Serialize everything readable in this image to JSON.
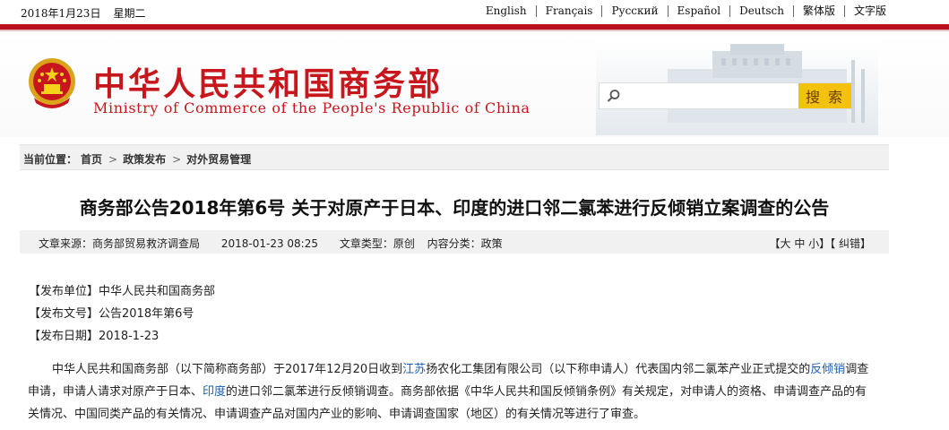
{
  "topbar": {
    "date": "2018年1月23日",
    "weekday": "星期二",
    "languages": [
      "English",
      "Français",
      "Русский",
      "Español",
      "Deutsch",
      "繁体版",
      "文字版"
    ]
  },
  "header": {
    "title_cn": "中华人民共和国商务部",
    "title_en": "Ministry of Commerce of the People's Republic of China",
    "search_placeholder": "",
    "search_button": "搜 索",
    "icons": [
      "national-emblem-icon",
      "search-icon",
      "building-icon"
    ]
  },
  "breadcrumb": {
    "label": "当前位置：",
    "items": [
      "首页",
      "政策发布",
      "对外贸易管理"
    ],
    "separator": ">"
  },
  "article": {
    "title": "商务部公告2018年第6号 关于对原产于日本、印度的进口邻二氯苯进行反倾销立案调查的公告",
    "meta": {
      "source": "文章来源：商务部贸易救济调查局",
      "datetime": "2018-01-23 08:25",
      "type": "文章类型：原创",
      "category": "内容分类：政策",
      "font_size_ctrl": "【大 中 小】",
      "correction": "【 纠错】"
    },
    "info": [
      "【发布单位】中华人民共和国商务部",
      "【发布文号】公告2018年第6号",
      "【发布日期】2018-1-23"
    ],
    "paragraph": {
      "p1": "中华人民共和国商务部（以下简称商务部）于2017年12月20日收到",
      "link1": "江苏",
      "p2": "扬农化工集团有限公司（以下称申请人）代表国内邻二氯苯产业正式提交的",
      "link2": "反倾销",
      "p3": "调查申请，申请人请求对原产于日本、",
      "link3": "印度",
      "p4": "的进口邻二氯苯进行反倾销调查。商务部依据《中华人民共和国反倾销条例》有关规定，对申请人的资格、申请调查产品的有关情况、中国同类产品的有关情况、申请调查产品对国内产业的影响、申请调查国家（地区）的有关情况等进行了审查。"
    }
  },
  "colors": {
    "brand_red": "#c8161d",
    "rule_red": "#b8111c",
    "search_yellow": "#f3c20f",
    "link_blue": "#1a5fb4"
  }
}
